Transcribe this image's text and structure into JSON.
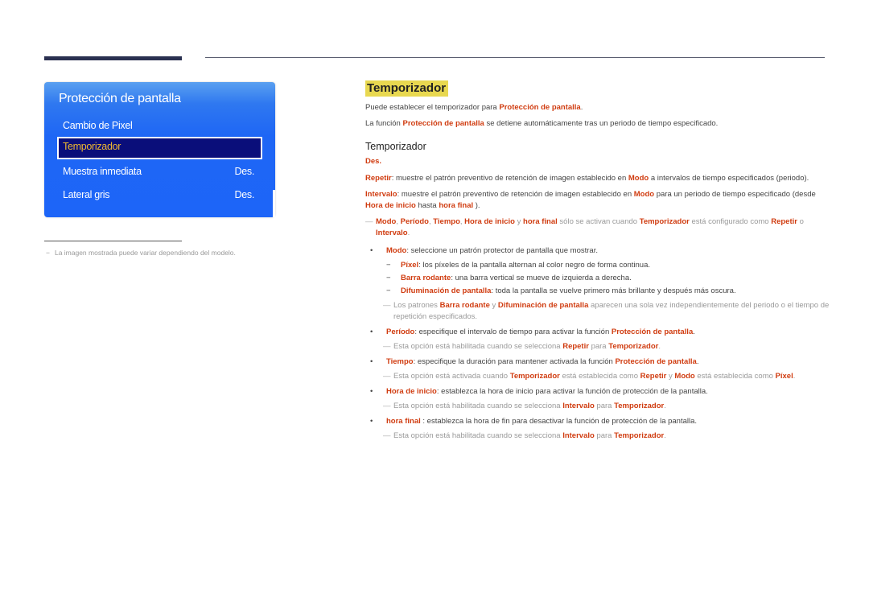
{
  "osd": {
    "title": "Protección de pantalla",
    "items": [
      {
        "label": "Cambio de Pixel",
        "value": ""
      },
      {
        "label": "Temporizador",
        "value": "",
        "selected": true
      },
      {
        "label": "Muestra inmediata",
        "value": "Des."
      },
      {
        "label": "Lateral gris",
        "value": "Des."
      }
    ]
  },
  "footnote": {
    "dash": "−",
    "text": "La imagen mostrada puede variar dependiendo del modelo."
  },
  "content": {
    "title": "Temporizador",
    "intro1": {
      "a": "Puede establecer el temporizador para ",
      "b": "Protección de pantalla",
      "c": "."
    },
    "intro2": {
      "a": "La función ",
      "b": "Protección de pantalla",
      "c": " se detiene automáticamente tras un periodo de tiempo especificado."
    },
    "subtitle": "Temporizador",
    "des": "Des.",
    "repetir": {
      "a": "Repetir",
      "b": ": muestre el patrón preventivo de retención de imagen establecido en ",
      "c": "Modo",
      "d": " a intervalos de tiempo especificados (periodo)."
    },
    "intervalo": {
      "a": "Intervalo",
      "b": ": muestre el patrón preventivo de retención de imagen establecido en ",
      "c": "Modo",
      "d": " para un periodo de tiempo especificado (desde ",
      "e": "Hora de inicio",
      "f": " hasta ",
      "g": "hora final",
      "h": " )."
    },
    "note1": {
      "mark": "—",
      "a": "Modo",
      "b": ", ",
      "c": "Período",
      "d": ", ",
      "e": "Tiempo",
      "f": ", ",
      "g": "Hora de inicio",
      "h": " y ",
      "i": "hora final",
      "j": "  sólo se activan cuando ",
      "k": "Temporizador",
      "l": " está configurado como ",
      "m": "Repetir",
      "n": " o ",
      "o": "Intervalo",
      "p": "."
    },
    "bullet_glyph": "•",
    "dash_glyph": "−",
    "modo": {
      "a": "Modo",
      "b": ": seleccione un patrón protector de pantalla que mostrar."
    },
    "modo_options": [
      {
        "name": "Píxel",
        "desc": ": los píxeles de la pantalla alternan al color negro de forma continua."
      },
      {
        "name": "Barra rodante",
        "desc": ": una barra vertical se mueve de izquierda a derecha."
      },
      {
        "name": "Difuminación de pantalla",
        "desc": ": toda la pantalla se vuelve primero más brillante y después más oscura."
      }
    ],
    "modo_note": {
      "mark": "—",
      "a": "Los patrones ",
      "b": "Barra rodante",
      "c": " y ",
      "d": "Difuminación de pantalla",
      "e": " aparecen una sola vez independientemente del periodo o el tiempo de repetición especificados."
    },
    "periodo": {
      "a": "Período",
      "b": ": especifique el intervalo de tiempo para activar la función ",
      "c": "Protección de pantalla",
      "d": "."
    },
    "periodo_note": {
      "mark": "—",
      "a": "Esta opción está habilitada cuando se selecciona ",
      "b": "Repetir",
      "c": " para ",
      "d": "Temporizador",
      "e": "."
    },
    "tiempo": {
      "a": "Tiempo",
      "b": ": especifique la duración para mantener activada la función ",
      "c": "Protección de pantalla",
      "d": "."
    },
    "tiempo_note": {
      "mark": "—",
      "a": "Esta opción está activada cuando ",
      "b": "Temporizador",
      "c": " está establecida como ",
      "d": "Repetir",
      "e": " y ",
      "f": "Modo",
      "g": " está establecida como ",
      "h": "Píxel",
      "i": "."
    },
    "hora_inicio": {
      "a": "Hora de inicio",
      "b": ": establezca la hora de inicio para activar la función de protección de la pantalla."
    },
    "hora_inicio_note": {
      "mark": "—",
      "a": "Esta opción está habilitada cuando se selecciona ",
      "b": "Intervalo",
      "c": " para ",
      "d": "Temporizador",
      "e": "."
    },
    "hora_final": {
      "a": "hora final",
      "b": " : establezca la hora de fin para desactivar la función de protección de la pantalla."
    },
    "hora_final_note": {
      "mark": "—",
      "a": "Esta opción está habilitada cuando se selecciona ",
      "b": "Intervalo",
      "c": " para ",
      "d": "Temporizador",
      "e": "."
    }
  }
}
